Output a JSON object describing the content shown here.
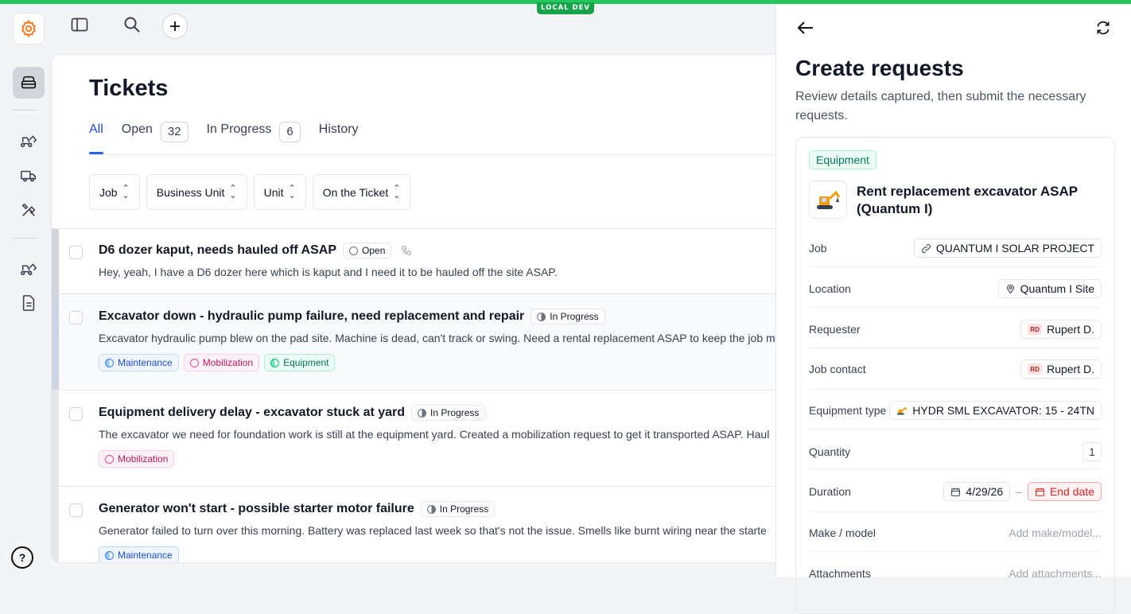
{
  "env_badge": "LOCAL DEV",
  "page": {
    "title": "Tickets"
  },
  "tabs": [
    {
      "label": "All"
    },
    {
      "label": "Open",
      "count": "32"
    },
    {
      "label": "In Progress",
      "count": "6"
    },
    {
      "label": "History"
    }
  ],
  "filters": [
    "Job",
    "Business Unit",
    "Unit",
    "On the Ticket"
  ],
  "tickets": [
    {
      "title": "D6 dozer kaput, needs hauled off ASAP",
      "status": "Open",
      "desc": "Hey, yeah, I have a D6 dozer here which is kaput and I need it to be hauled off the site ASAP.",
      "tags": []
    },
    {
      "title": "Excavator down - hydraulic pump failure, need replacement and repair",
      "status": "In Progress",
      "desc": "Excavator hydraulic pump blew on the pad site. Machine is dead, can't track or swing. Need a rental replacement ASAP to keep the job m",
      "tags": [
        "Maintenance",
        "Mobilization",
        "Equipment"
      ]
    },
    {
      "title": "Equipment delivery delay - excavator stuck at yard",
      "status": "In Progress",
      "desc": "The excavator we need for foundation work is still at the equipment yard. Created a mobilization request to get it transported ASAP. Haul",
      "tags": [
        "Mobilization"
      ]
    },
    {
      "title": "Generator won't start - possible starter motor failure",
      "status": "In Progress",
      "desc": "Generator failed to turn over this morning. Battery was replaced last week so that's not the issue. Smells like burnt wiring near the starte",
      "tags": [
        "Maintenance"
      ]
    }
  ],
  "side": {
    "title": "Create requests",
    "subtitle": "Review details captured, then submit the necessary requests.",
    "badge": "Equipment",
    "request_title": "Rent replacement excavator ASAP (Quantum I)",
    "fields": {
      "job_label": "Job",
      "job_value": "QUANTUM I SOLAR PROJECT",
      "location_label": "Location",
      "location_value": "Quantum I Site",
      "requester_label": "Requester",
      "requester_initials": "RD",
      "requester_value": "Rupert D.",
      "contact_label": "Job contact",
      "contact_initials": "RD",
      "contact_value": "Rupert D.",
      "eqtype_label": "Equipment type",
      "eqtype_value": "HYDR SML EXCAVATOR: 15 - 24TN",
      "qty_label": "Quantity",
      "qty_value": "1",
      "duration_label": "Duration",
      "start_date": "4/29/26",
      "duration_sep": "–",
      "end_date": "End date",
      "make_label": "Make / model",
      "make_placeholder": "Add make/model...",
      "attach_label": "Attachments",
      "attach_placeholder": "Add attachments..."
    }
  }
}
